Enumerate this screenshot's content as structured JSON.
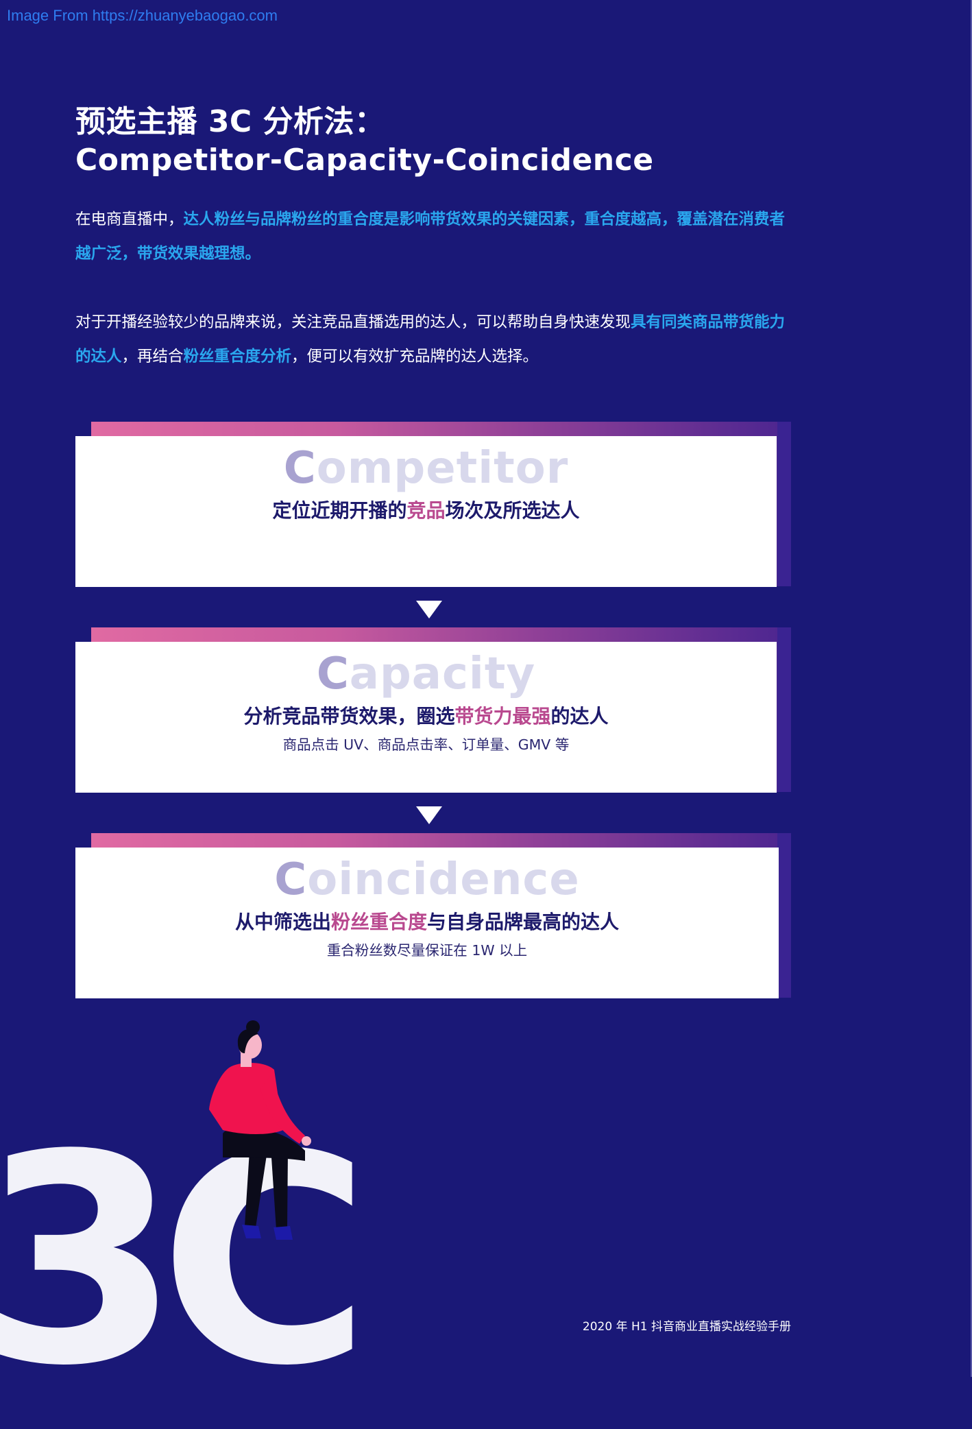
{
  "watermark": "Image From https://zhuanyebaogao.com",
  "title": {
    "line1": "预选主播 3C 分析法：",
    "line2": "Competitor-Capacity-Coincidence"
  },
  "paragraph1": {
    "normal": "在电商直播中，",
    "highlight": "达人粉丝与品牌粉丝的重合度是影响带货效果的关键因素，重合度越高，覆盖潜在消费者越广泛，带货效果越理想。"
  },
  "paragraph2": {
    "part1": "对于开播经验较少的品牌来说，关注竞品直播选用的达人，可以帮助自身快速发现",
    "hl1": "具有同类商品带货能力的达人",
    "part2": "，再结合",
    "hl2": "粉丝重合度分析",
    "part3": "，便可以有效扩充品牌的达人选择。"
  },
  "cards": [
    {
      "big_first": "C",
      "big_rest": "ompetitor",
      "head_before": "定位近期开播的",
      "head_highlight": "竞品",
      "head_after": "场次及所选达人",
      "sub": ""
    },
    {
      "big_first": "C",
      "big_rest": "apacity",
      "head_before": "分析竞品带货效果，圈选",
      "head_highlight": "带货力最强",
      "head_after": "的达人",
      "sub": "商品点击 UV、商品点击率、订单量、GMV 等"
    },
    {
      "big_first": "C",
      "big_rest": "oincidence",
      "head_before": "从中筛选出",
      "head_highlight": "粉丝重合度",
      "head_after": "与自身品牌最高的达人",
      "sub": "重合粉丝数尽量保证在 1W 以上"
    }
  ],
  "decor_text": "3C",
  "footer": "2020 年 H1 抖音商业直播实战经验手册",
  "colors": {
    "background": "#1a1877",
    "highlight_blue": "#2aa7ee",
    "highlight_pink": "#b9498f",
    "card_text": "#1d1a6b",
    "figure_shirt": "#f0134e"
  },
  "icons": [
    "down-arrow-icon",
    "person-illustration"
  ]
}
